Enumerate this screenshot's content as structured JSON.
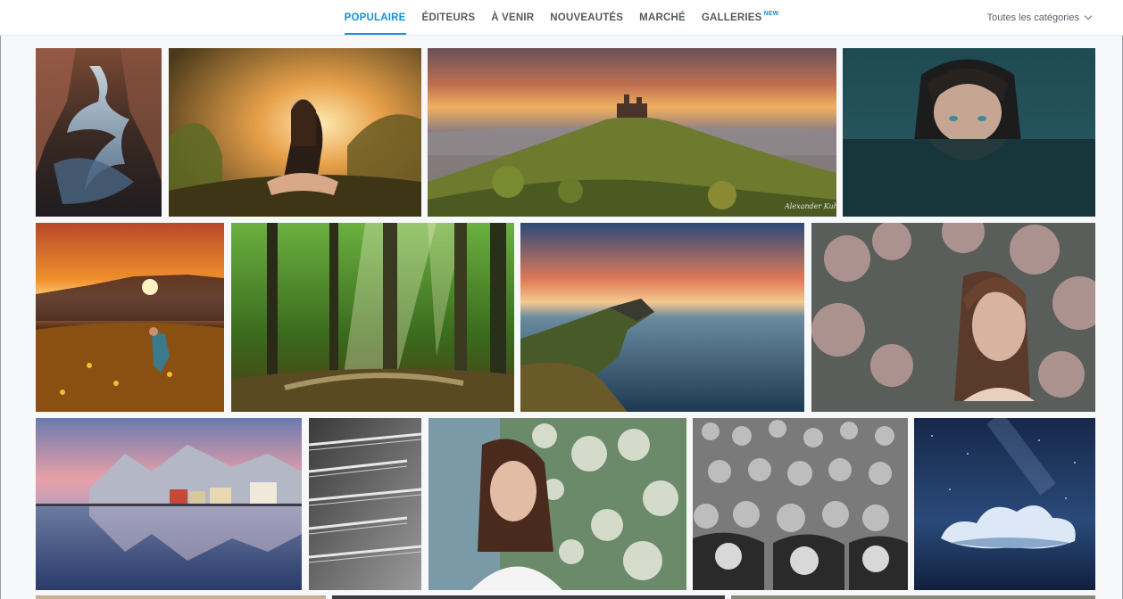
{
  "nav": {
    "tabs": [
      {
        "label": "POPULAIRE",
        "active": true
      },
      {
        "label": "ÉDITEURS",
        "active": false
      },
      {
        "label": "À VENIR",
        "active": false
      },
      {
        "label": "NOUVEAUTÉS",
        "active": false
      },
      {
        "label": "MARCHÉ",
        "active": false
      },
      {
        "label": "GALLERIES",
        "active": false,
        "badge": "NEW"
      }
    ],
    "category_label": "Toutes les catégories",
    "accent_color": "#1a8fd8"
  },
  "photos": [
    {
      "subject": "canyon stream"
    },
    {
      "subject": "woman in grass at sunset"
    },
    {
      "subject": "castle on hill",
      "watermark": "Alexander Kuhl"
    },
    {
      "subject": "woman in water"
    },
    {
      "subject": "girl in golden field at sunset"
    },
    {
      "subject": "forest sunbeams"
    },
    {
      "subject": "coastal cliff seascape"
    },
    {
      "subject": "woman among pink blossoms"
    },
    {
      "subject": "snowy mountain harbor town"
    },
    {
      "subject": "spiral staircase abstract"
    },
    {
      "subject": "woman behind white flowers"
    },
    {
      "subject": "crowd of children black and white"
    },
    {
      "subject": "cloud under milky way"
    }
  ]
}
